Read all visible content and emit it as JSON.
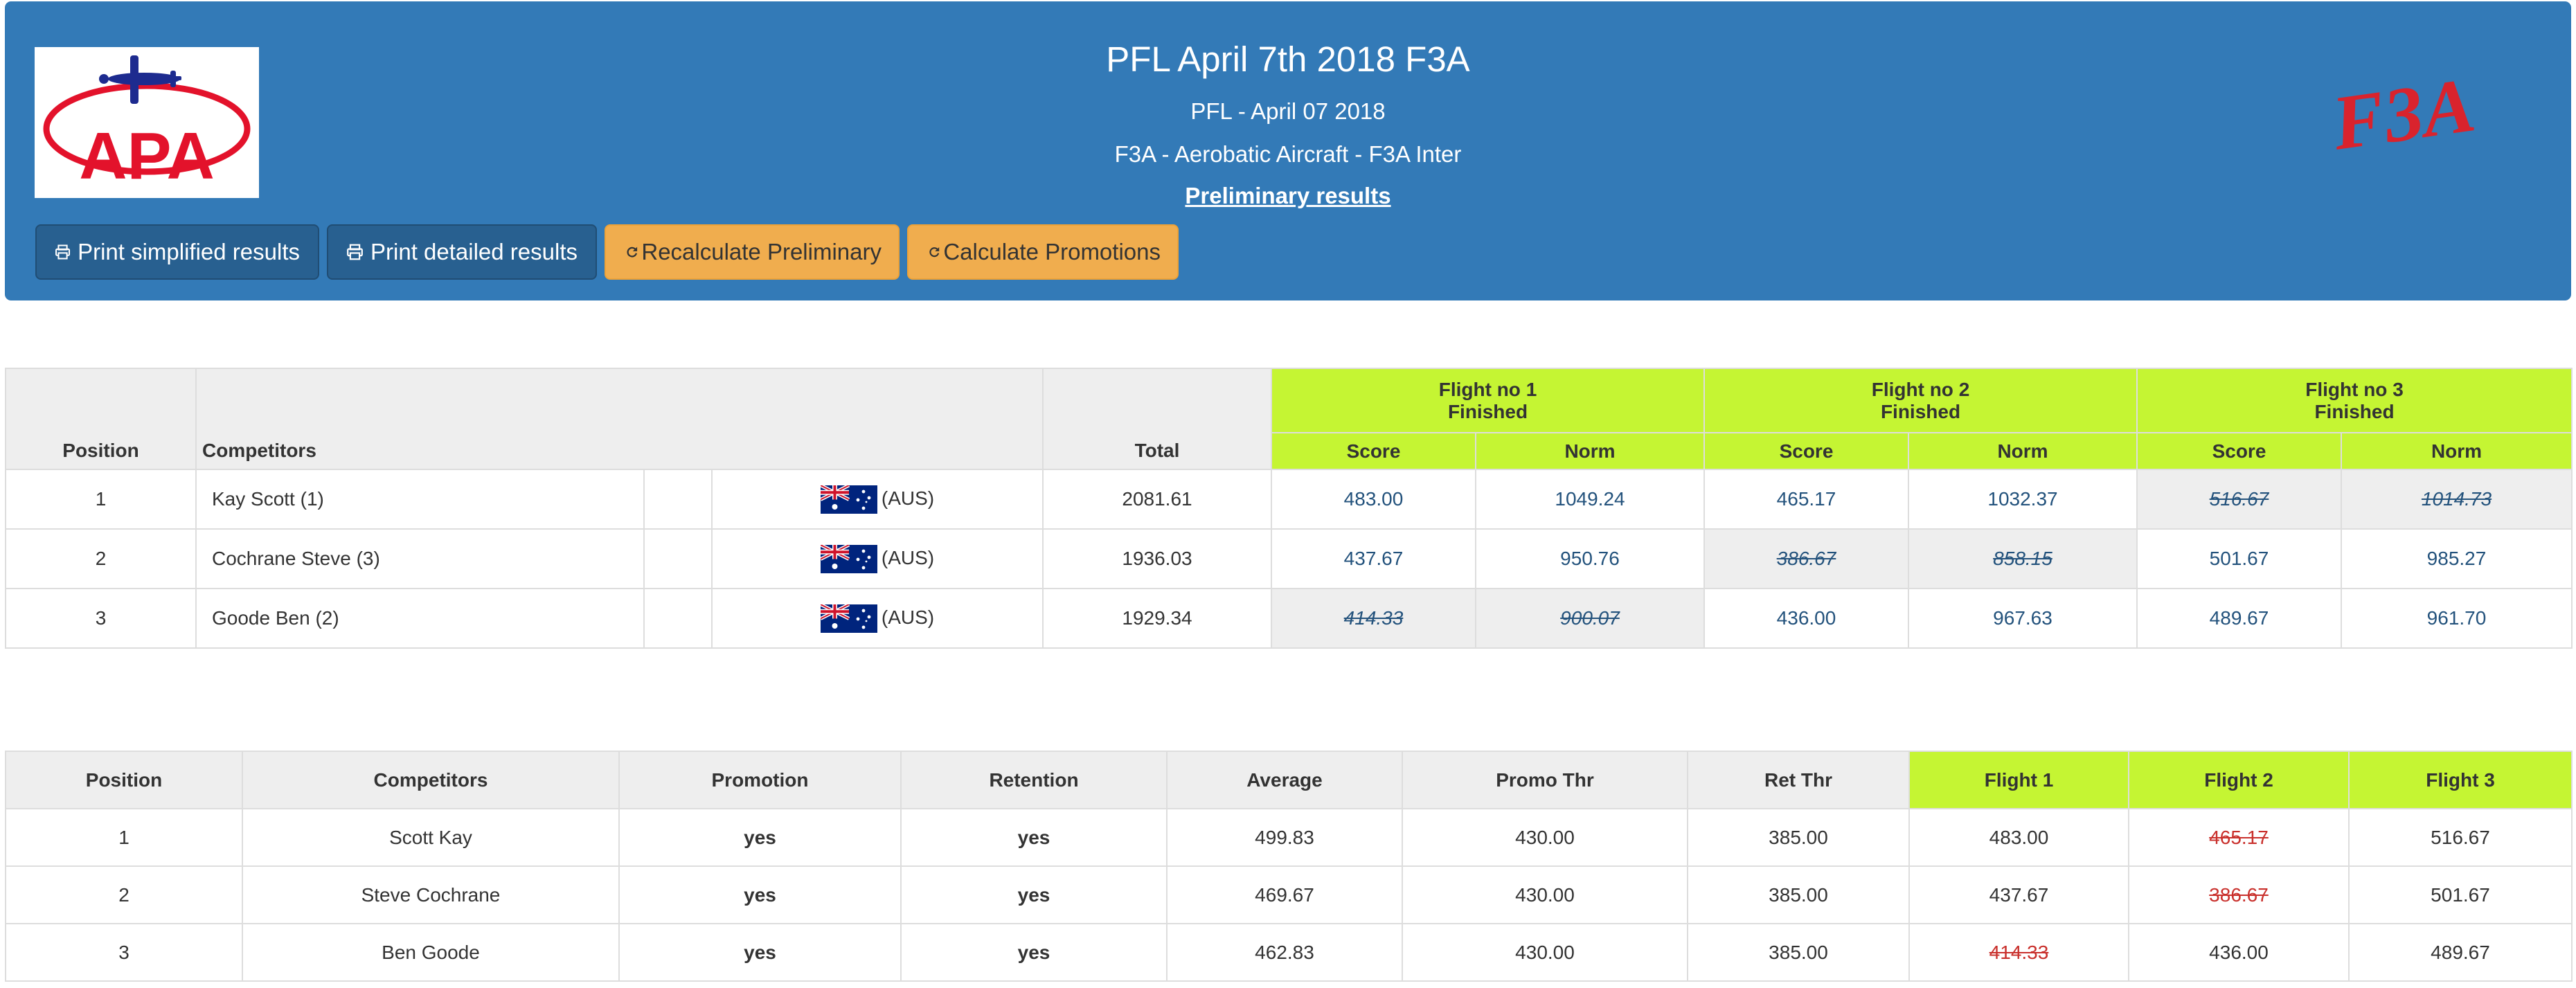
{
  "header": {
    "event_title": "PFL April 7th 2018 F3A",
    "event_date_line": "PFL - April 07 2018",
    "class_line": "F3A - Aerobatic Aircraft - F3A Inter",
    "preliminary_link": "Preliminary results",
    "logo_left_text": "APA",
    "logo_right_text": "F3A",
    "brand_color": "#337ab7",
    "buttons": {
      "print_simplified": "Print simplified results",
      "print_detailed": "Print detailed results",
      "recalc_preliminary": "Recalculate Preliminary",
      "calc_promotions": "Calculate Promotions"
    }
  },
  "results_table": {
    "headers": {
      "position": "Position",
      "competitors": "Competitors",
      "total": "Total",
      "flights": [
        {
          "title": "Flight no 1",
          "status": "Finished"
        },
        {
          "title": "Flight no 2",
          "status": "Finished"
        },
        {
          "title": "Flight no 3",
          "status": "Finished"
        }
      ],
      "score": "Score",
      "norm": "Norm"
    },
    "rows": [
      {
        "position": "1",
        "name": "Kay Scott (1)",
        "country": "(AUS)",
        "total": "2081.61",
        "flights": [
          {
            "score": "483.00",
            "norm": "1049.24",
            "dropped": false
          },
          {
            "score": "465.17",
            "norm": "1032.37",
            "dropped": false
          },
          {
            "score": "516.67",
            "norm": "1014.73",
            "dropped": true
          }
        ]
      },
      {
        "position": "2",
        "name": "Cochrane Steve (3)",
        "country": "(AUS)",
        "total": "1936.03",
        "flights": [
          {
            "score": "437.67",
            "norm": "950.76",
            "dropped": false
          },
          {
            "score": "386.67",
            "norm": "858.15",
            "dropped": true
          },
          {
            "score": "501.67",
            "norm": "985.27",
            "dropped": false
          }
        ]
      },
      {
        "position": "3",
        "name": "Goode Ben (2)",
        "country": "(AUS)",
        "total": "1929.34",
        "flights": [
          {
            "score": "414.33",
            "norm": "900.07",
            "dropped": true
          },
          {
            "score": "436.00",
            "norm": "967.63",
            "dropped": false
          },
          {
            "score": "489.67",
            "norm": "961.70",
            "dropped": false
          }
        ]
      }
    ]
  },
  "promotion_table": {
    "headers": [
      "Position",
      "Competitors",
      "Promotion",
      "Retention",
      "Average",
      "Promo Thr",
      "Ret Thr",
      "Flight 1",
      "Flight 2",
      "Flight 3"
    ],
    "rows": [
      {
        "position": "1",
        "name": "Scott Kay",
        "promotion": "yes",
        "retention": "yes",
        "average": "499.83",
        "promo_thr": "430.00",
        "ret_thr": "385.00",
        "flights": [
          {
            "v": "483.00",
            "dropped": false
          },
          {
            "v": "465.17",
            "dropped": true
          },
          {
            "v": "516.67",
            "dropped": false
          }
        ]
      },
      {
        "position": "2",
        "name": "Steve Cochrane",
        "promotion": "yes",
        "retention": "yes",
        "average": "469.67",
        "promo_thr": "430.00",
        "ret_thr": "385.00",
        "flights": [
          {
            "v": "437.67",
            "dropped": false
          },
          {
            "v": "386.67",
            "dropped": true
          },
          {
            "v": "501.67",
            "dropped": false
          }
        ]
      },
      {
        "position": "3",
        "name": "Ben Goode",
        "promotion": "yes",
        "retention": "yes",
        "average": "462.83",
        "promo_thr": "430.00",
        "ret_thr": "385.00",
        "flights": [
          {
            "v": "414.33",
            "dropped": true
          },
          {
            "v": "436.00",
            "dropped": false
          },
          {
            "v": "489.67",
            "dropped": false
          }
        ]
      }
    ]
  },
  "colors": {
    "flight_header_green": "#c5f533",
    "score_link_blue": "#23527c",
    "dropped_red": "#c9302c",
    "warning_button": "#f0ad4e"
  }
}
